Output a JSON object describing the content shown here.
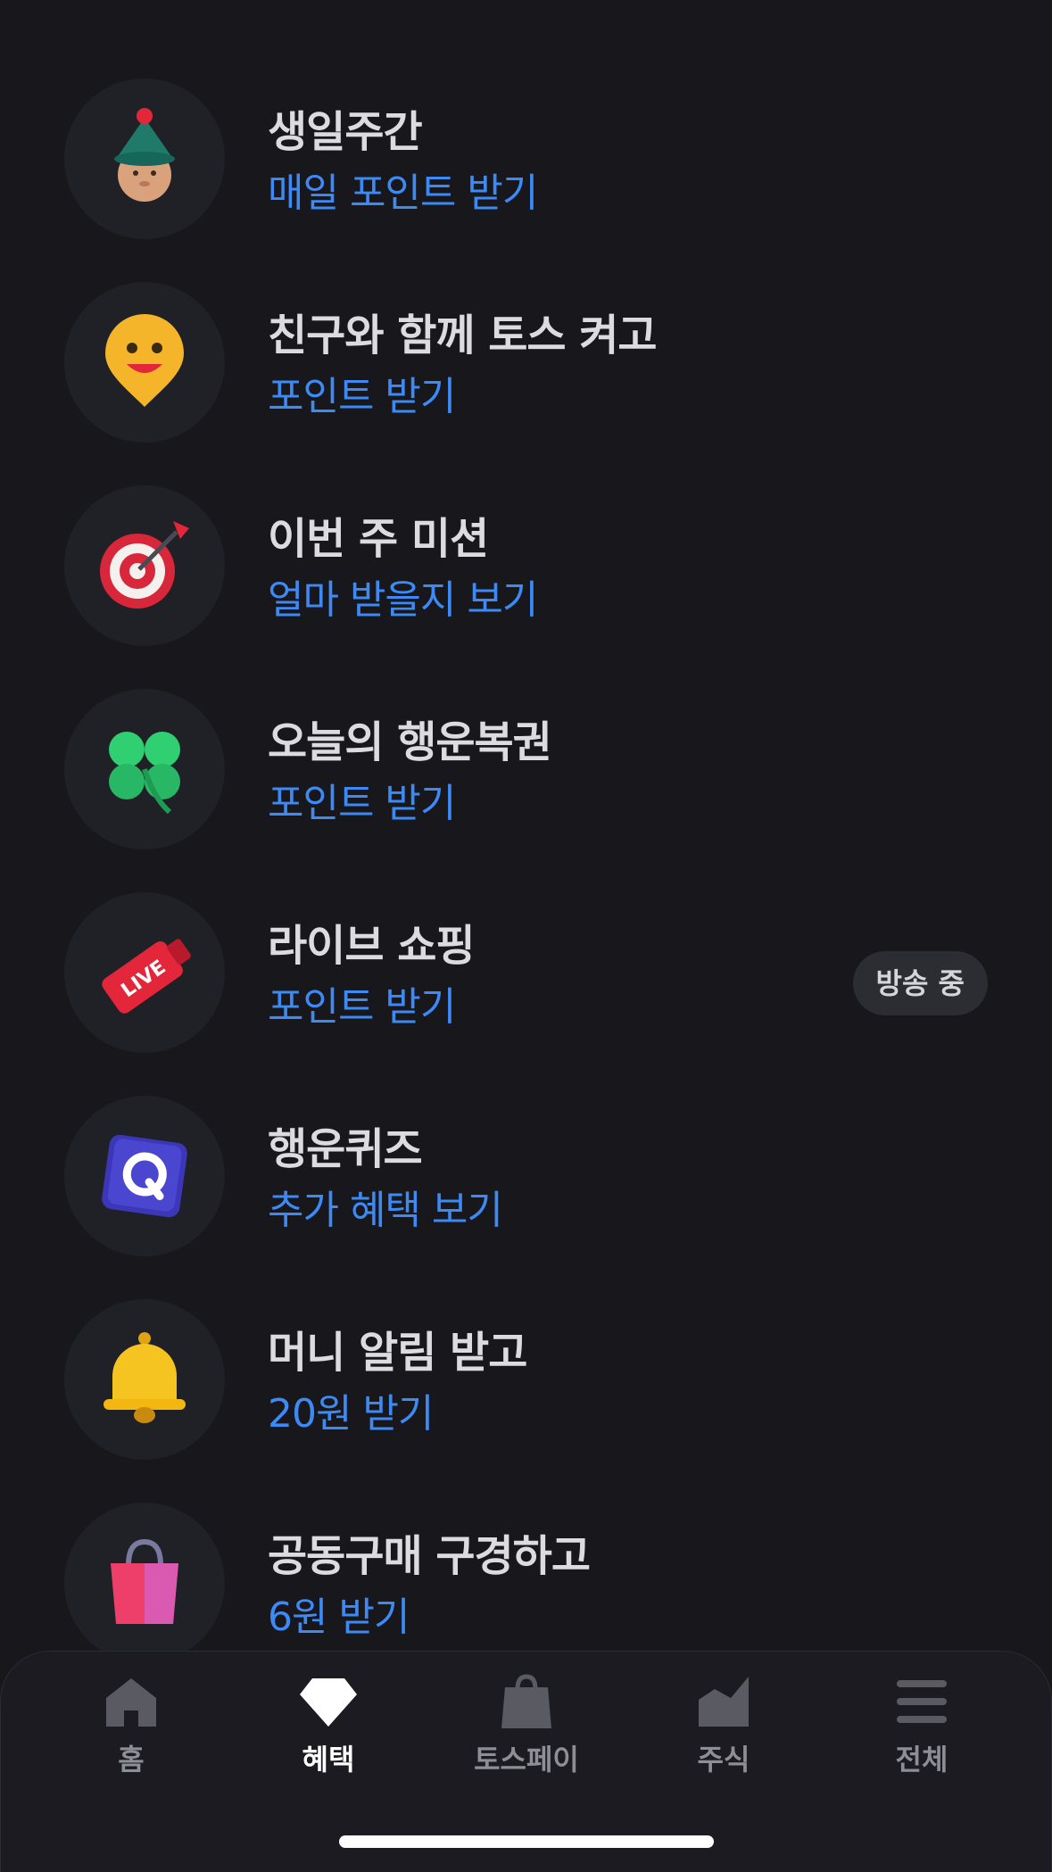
{
  "items": [
    {
      "title": "생일주간",
      "sub": "매일 포인트 받기",
      "icon": "party-hat-face-icon"
    },
    {
      "title": "친구와 함께 토스 켜고",
      "sub": "포인트 받기",
      "icon": "smiley-pin-icon"
    },
    {
      "title": "이번 주 미션",
      "sub": "얼마 받을지 보기",
      "icon": "target-dart-icon"
    },
    {
      "title": "오늘의 행운복권",
      "sub": "포인트 받기",
      "icon": "four-leaf-clover-icon"
    },
    {
      "title": "라이브 쇼핑",
      "sub": "포인트 받기",
      "badge": "방송 중",
      "icon": "live-megaphone-icon"
    },
    {
      "title": "행운퀴즈",
      "sub": "추가 혜택 보기",
      "icon": "quiz-q-icon"
    },
    {
      "title": "머니 알림 받고",
      "sub": "20원 받기",
      "icon": "bell-icon"
    },
    {
      "title": "공동구매 구경하고",
      "sub": "6원 받기",
      "icon": "shopping-bag-icon"
    }
  ],
  "tabs": [
    {
      "label": "홈",
      "icon": "home-icon",
      "active": false
    },
    {
      "label": "혜택",
      "icon": "diamond-icon",
      "active": true
    },
    {
      "label": "토스페이",
      "icon": "bag-icon",
      "active": false
    },
    {
      "label": "주식",
      "icon": "chart-icon",
      "active": false
    },
    {
      "label": "전체",
      "icon": "menu-icon",
      "active": false
    }
  ],
  "colors": {
    "background": "#17171c",
    "accent": "#3d8af5",
    "title": "#dcdce0",
    "icon_bg": "#202027"
  }
}
